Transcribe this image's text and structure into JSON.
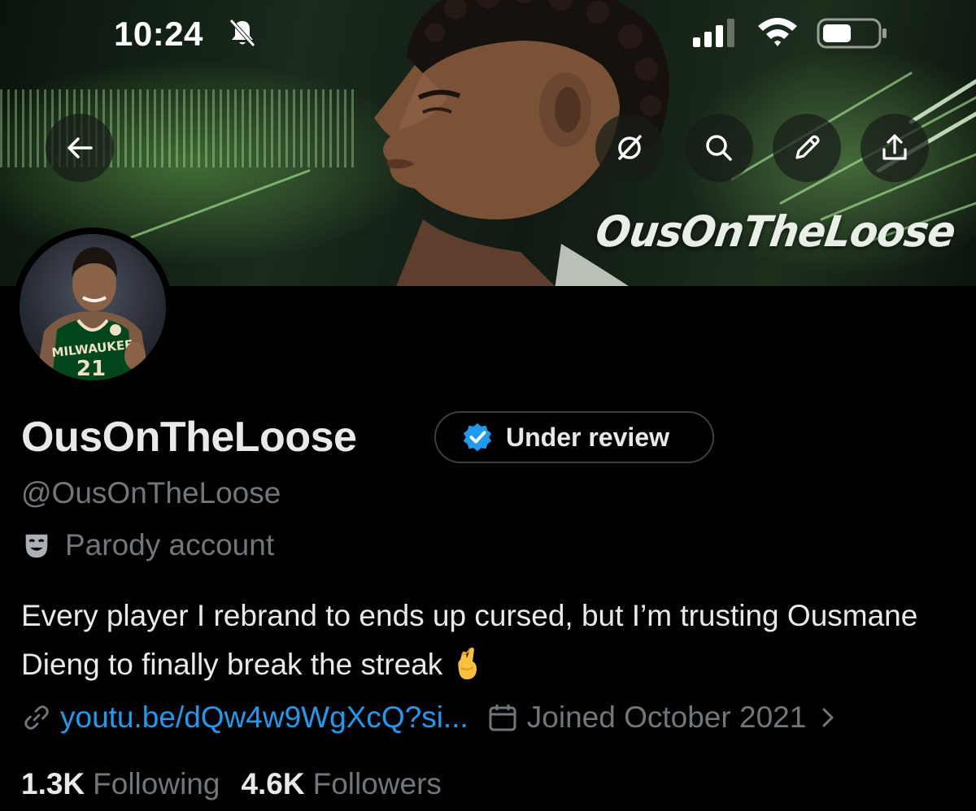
{
  "status_bar": {
    "time": "10:24"
  },
  "banner": {
    "wordmark": "OusOnTheLoose"
  },
  "profile": {
    "display_name": "OusOnTheLoose",
    "verification_badge_label": "Under review",
    "handle": "@OusOnTheLoose",
    "account_label": "Parody account",
    "bio": "Every player I rebrand to ends up cursed, but I’m trusting Ousmane Dieng to finally break the streak",
    "website": "youtu.be/dQw4w9WgXcQ?si...",
    "joined": "Joined October 2021",
    "following_count": "1.3K",
    "following_label": "Following",
    "followers_count": "4.6K",
    "followers_label": "Followers",
    "jersey_text": "MILWAUKEE",
    "jersey_number": "21"
  },
  "icons": {
    "back": "back-arrow-icon",
    "grok": "grok-icon",
    "search": "search-icon",
    "edit": "pencil-icon",
    "share": "share-icon",
    "verified": "verified-check-icon",
    "parody": "theater-mask-icon",
    "link": "link-icon",
    "calendar": "calendar-icon",
    "emoji": "crossed-fingers-emoji"
  },
  "colors": {
    "background": "#000000",
    "primary_text": "#e7e9ea",
    "secondary_text": "#71767b",
    "link": "#1d9bf0",
    "verified_blue": "#1d9bf0",
    "bucks_green": "#00471b"
  }
}
